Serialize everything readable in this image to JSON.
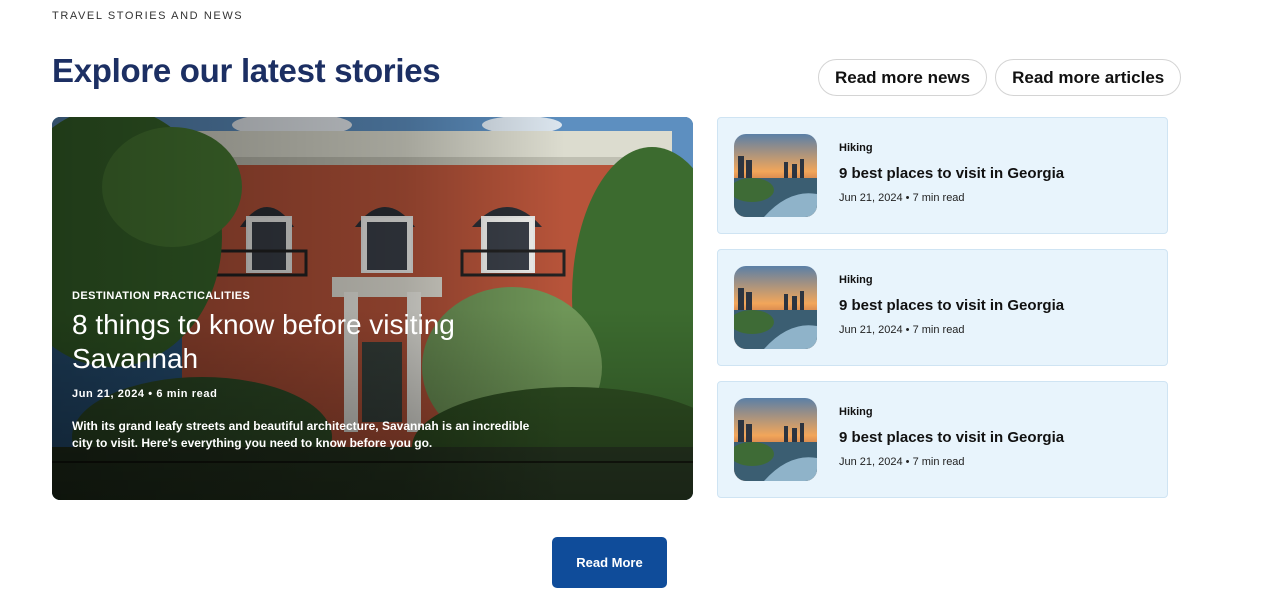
{
  "header": {
    "eyebrow": "TRAVEL STORIES AND NEWS",
    "title": "Explore our latest stories",
    "actions": [
      "Read more news",
      "Read more articles"
    ]
  },
  "featured": {
    "category": "DESTINATION PRACTICALITIES",
    "title": "8 things to know before visiting Savannah",
    "meta": "Jun 21, 2024 • 6 min read",
    "description": "With its grand leafy streets and beautiful architecture, Savannah is an incredible city to visit. Here's everything you need to know before you go."
  },
  "side_articles": [
    {
      "category": "Hiking",
      "title": "9 best places to visit in Georgia",
      "meta": "Jun 21, 2024 • 7 min read"
    },
    {
      "category": "Hiking",
      "title": "9 best places to visit in Georgia",
      "meta": "Jun 21, 2024 • 7 min read"
    },
    {
      "category": "Hiking",
      "title": "9 best places to visit in Georgia",
      "meta": "Jun 21, 2024 • 7 min read"
    }
  ],
  "read_more_label": "Read More",
  "colors": {
    "title": "#1c2f63",
    "card_bg": "#e8f4fc",
    "button_bg": "#0f4c9a"
  }
}
